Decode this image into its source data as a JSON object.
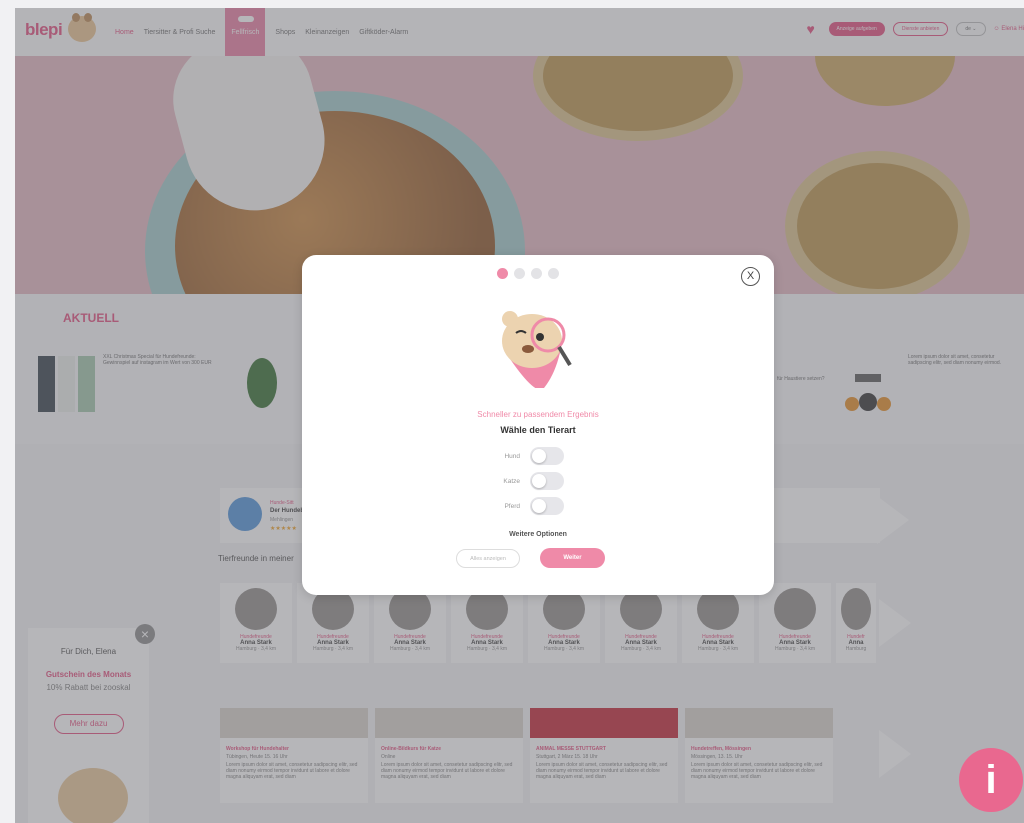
{
  "header": {
    "logo": "blepi",
    "nav": [
      "Home",
      "Tiersitter & Profi Suche",
      "Fellfrisch",
      "Shops",
      "Kleinanzeigen",
      "Giftköder-Alarm"
    ],
    "post_ad": "Anzeige aufgeben",
    "offer_service": "Dienste anbieten",
    "lang": "de",
    "user": "Elena Hi"
  },
  "aktuell": {
    "title": "AKTUELL",
    "items": [
      {
        "text": "XXL Christmas Special für Hundefreunde: Gewinnspiel auf instagram im Wert von 300 EUR"
      },
      {
        "text": "für Haustiere setzen?"
      },
      {
        "text": "Lorem ipsum dolor sit amet, consetetur sadipscing elitr, sed diam nonumy eirmod."
      }
    ]
  },
  "modal": {
    "subtitle": "Schneller zu passendem Ergebnis",
    "title": "Wähle den Tierart",
    "options": [
      "Hund",
      "Katze",
      "Pferd"
    ],
    "more": "Weitere Optionen",
    "show_all": "Alles anzeigen",
    "next": "Weiter"
  },
  "section": {
    "tierfreunde": "Tierfreunde in meiner",
    "top_name": "Der Hundeb",
    "top_role": "Hunde-Sitt",
    "top_city": "Mehlingen"
  },
  "cards": [
    {
      "role": "Hundefreunde",
      "name": "Anna Stark",
      "loc": "Hamburg · 3,4 km"
    },
    {
      "role": "Hundefreunde",
      "name": "Anna Stark",
      "loc": "Hamburg · 3,4 km"
    },
    {
      "role": "Hundefreunde",
      "name": "Anna Stark",
      "loc": "Hamburg · 3,4 km"
    },
    {
      "role": "Hundefreunde",
      "name": "Anna Stark",
      "loc": "Hamburg · 3,4 km"
    },
    {
      "role": "Hundefreunde",
      "name": "Anna Stark",
      "loc": "Hamburg · 3,4 km"
    },
    {
      "role": "Hundefreunde",
      "name": "Anna Stark",
      "loc": "Hamburg · 3,4 km"
    },
    {
      "role": "Hundefreunde",
      "name": "Anna Stark",
      "loc": "Hamburg · 3,4 km"
    },
    {
      "role": "Hundefreunde",
      "name": "Anna Stark",
      "loc": "Hamburg · 3,4 km"
    },
    {
      "role": "Hundefr",
      "name": "Anna",
      "loc": "Hamburg"
    }
  ],
  "events": [
    {
      "title": "Workshop für Hundehalter",
      "date": "Tübingen, Heute 15. 16 Uhr",
      "body": "Lorem ipsum dolor sit amet, consetetur sadipscing elitr, sed diam nonumy eirmod tempor invidunt ut labore et dolore magna aliquyam erat, sed diam"
    },
    {
      "title": "Online-Bildkurs für Katze",
      "date": "Online",
      "body": "Lorem ipsum dolor sit amet, consetetur sadipscing elitr, sed diam nonumy eirmod tempor invidunt ut labore et dolore magna aliquyam erat, sed diam"
    },
    {
      "title": "ANIMAL MESSE STUTTGART",
      "date": "Stuttgart, 2 März 15. 18 Uhr",
      "body": "Lorem ipsum dolor sit amet, consetetur sadipscing elitr, sed diam nonumy eirmod tempor invidunt ut labore et dolore magna aliquyam erat, sed diam"
    },
    {
      "title": "Hundetreffen, Mössingen",
      "date": "Mössingen, 13. 15. Uhr",
      "body": "Lorem ipsum dolor sit amet, consetetur sadipscing elitr, sed diam nonumy eirmod tempor invidunt ut labore et dolore magna aliquyam erat, sed diam"
    }
  ],
  "coupon": {
    "greeting": "Für Dich, Elena",
    "headline": "Gutschein des Monats",
    "offer": "10% Rabatt bei zooskal",
    "cta": "Mehr dazu"
  },
  "info_icon": "i"
}
